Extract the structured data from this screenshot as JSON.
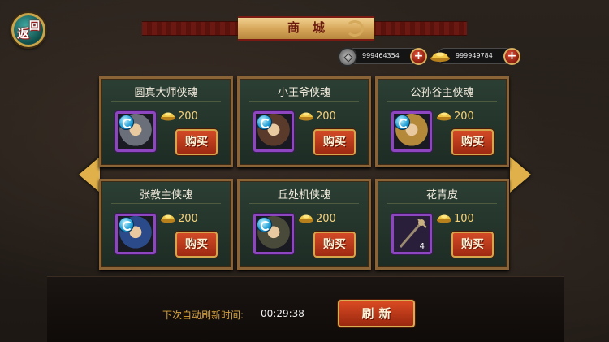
{
  "back_button": {
    "label_top": "回",
    "label_bottom": "返"
  },
  "title": "商城",
  "currency": {
    "coins": "999464354",
    "ingots": "999949784"
  },
  "items": [
    {
      "name": "圆真大师侠魂",
      "price": "200",
      "buy_label": "购买",
      "type": "soul",
      "portrait_color": "#6b6f7a"
    },
    {
      "name": "小王爷侠魂",
      "price": "200",
      "buy_label": "购买",
      "type": "soul",
      "portrait_color": "#5a3a2a"
    },
    {
      "name": "公孙谷主侠魂",
      "price": "200",
      "buy_label": "购买",
      "type": "soul",
      "portrait_color": "#b48a3a"
    },
    {
      "name": "张教主侠魂",
      "price": "200",
      "buy_label": "购买",
      "type": "soul",
      "portrait_color": "#2a4a8a"
    },
    {
      "name": "丘处机侠魂",
      "price": "200",
      "buy_label": "购买",
      "type": "soul",
      "portrait_color": "#4a4a3a"
    },
    {
      "name": "花青皮",
      "price": "100",
      "buy_label": "购买",
      "type": "item",
      "count": "4",
      "portrait_color": "#2a1f3a"
    }
  ],
  "refresh": {
    "label": "下次自动刷新时间:",
    "time": "00:29:38",
    "button_label": "刷新"
  },
  "colors": {
    "panel_border": "#8a6436",
    "buy_button": "#c23c1c",
    "price_text": "#f6d27a",
    "accent_gold": "#e0b14a"
  }
}
